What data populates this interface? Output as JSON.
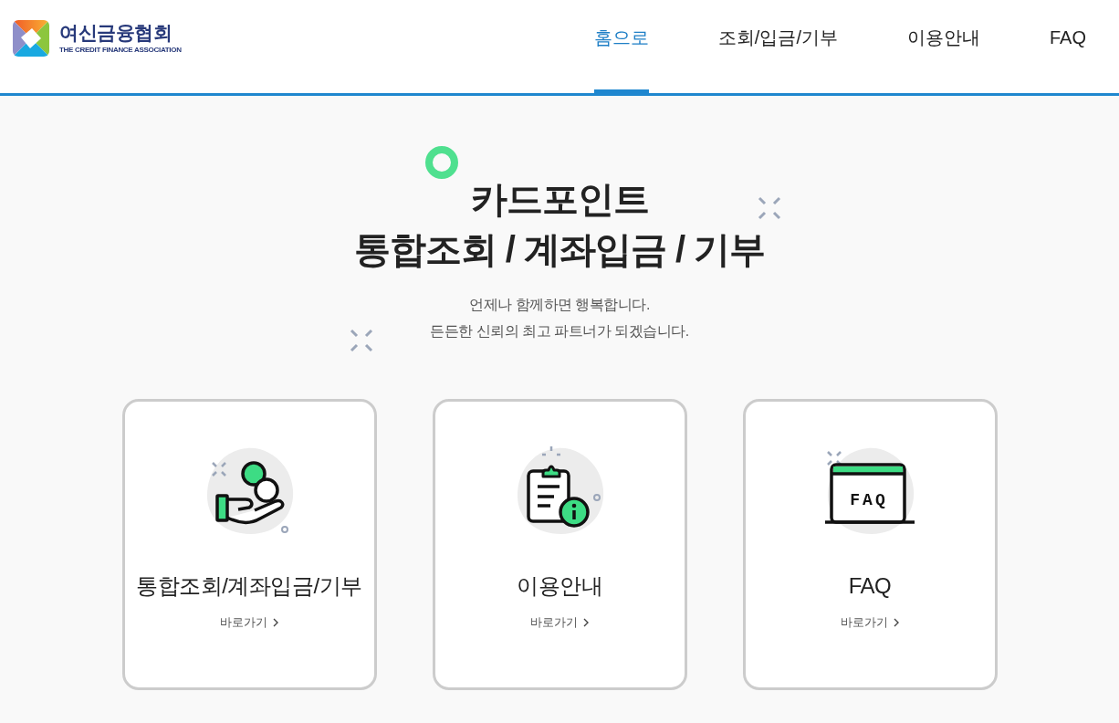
{
  "logo": {
    "name": "여신금융협회",
    "tagline": "THE CREDIT FINANCE ASSOCIATION"
  },
  "nav": [
    {
      "label": "홈으로",
      "selected": true
    },
    {
      "label": "조회/입금/기부",
      "selected": false
    },
    {
      "label": "이용안내",
      "selected": false
    },
    {
      "label": "FAQ",
      "selected": false
    }
  ],
  "hero": {
    "title_lines": [
      "카드포인트",
      "통합조회 / 계좌입금 / 기부"
    ],
    "subtitle_lines": [
      "언제나 함께하면 행복합니다.",
      "든든한 신뢰의 최고 파트너가 되겠습니다."
    ]
  },
  "cards": [
    {
      "kind": "coin-hand",
      "title": "통합조회/계좌입금/기부",
      "link": "바로가기"
    },
    {
      "kind": "clipboard-info",
      "title": "이용안내",
      "link": "바로가기"
    },
    {
      "kind": "faq-window",
      "icon_text": "FAQ",
      "title": "FAQ",
      "link": "바로가기"
    }
  ]
}
